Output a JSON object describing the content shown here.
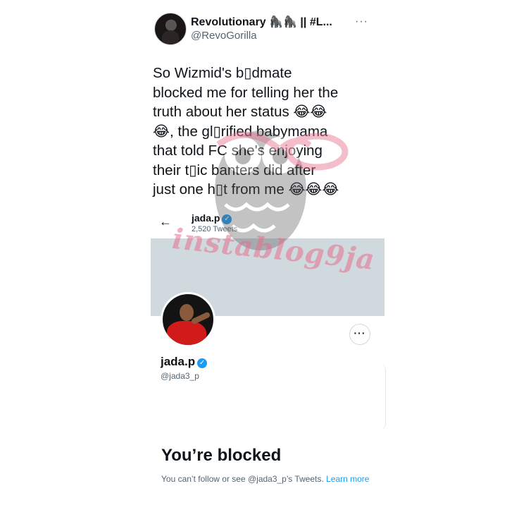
{
  "tweet": {
    "author_name": "Revolutionary 🦍🦍 || #L...",
    "author_handle": "@RevoGorilla",
    "more_label": "···",
    "text": "So Wizmid's b▯dmate\nblocked me for telling her the\ntruth about her status 😂😂\n😂, the gl▯rified babymama\nthat told FC she's enjoying\ntheir t▯ic banters did after\njust one h▯t from me 😂😂😂"
  },
  "profile": {
    "back_icon": "←",
    "topbar_name": "jada.p",
    "tweet_count": "2,520 Tweets",
    "display_name": "jada.p",
    "verified_icon": "✓",
    "handle": "@jada3_p",
    "more_label": "···"
  },
  "blocked": {
    "title": "You’re blocked",
    "description": "You can’t follow or see @jada3_p’s Tweets. ",
    "learn_more": "Learn more"
  },
  "watermark": {
    "text": "instablog9ja"
  },
  "colors": {
    "accent": "#1d9bf0",
    "banner": "#cfd9de",
    "secondary_text": "#536471",
    "watermark": "#e86e8c"
  }
}
